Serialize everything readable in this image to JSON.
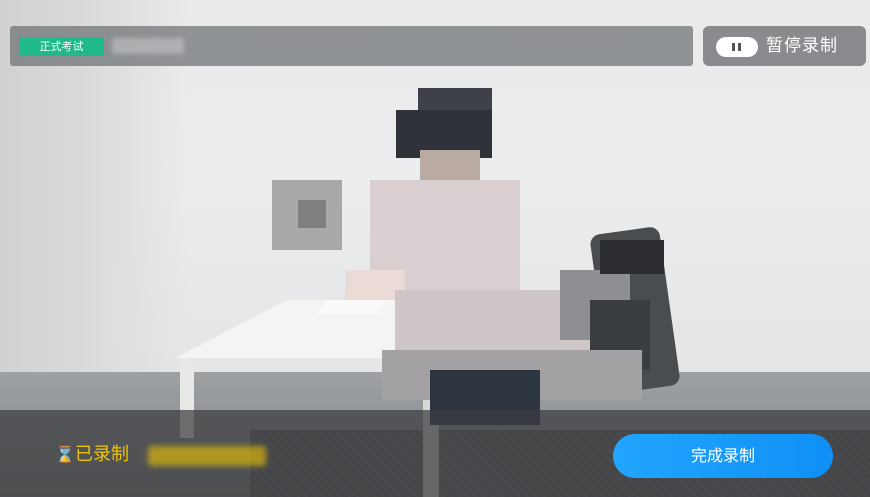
{
  "header": {
    "exam_badge": "正式考试",
    "pause_label": "暂停录制"
  },
  "footer": {
    "recorded_label": "已录制",
    "finish_label": "完成录制"
  },
  "colors": {
    "badge_green": "#1fb98a",
    "accent_yellow": "#f0c400",
    "button_blue": "#0f8ff5"
  },
  "icons": {
    "pause": "pause-icon",
    "timer": "hourglass-icon"
  }
}
